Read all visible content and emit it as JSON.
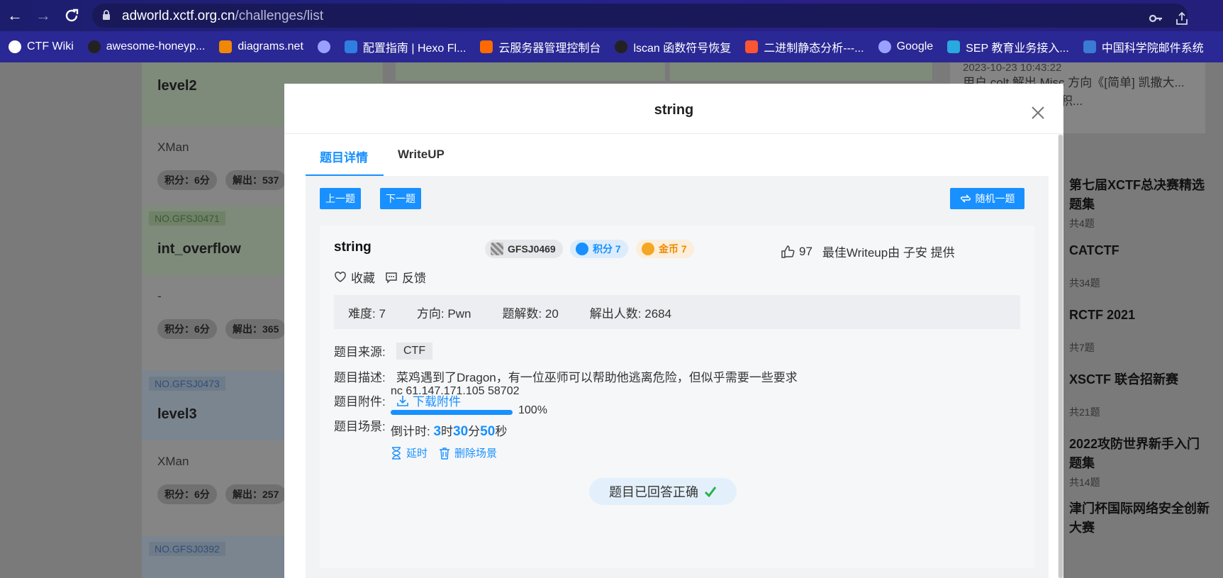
{
  "browser": {
    "url_domain": "adworld.xctf.org.cn",
    "url_path": "/challenges/list",
    "bookmarks": [
      {
        "label": "CTF Wiki",
        "icon": "ctfwiki-icon",
        "color": "#ffffff"
      },
      {
        "label": "awesome-honeyp...",
        "icon": "github-icon",
        "color": "#222222"
      },
      {
        "label": "diagrams.net",
        "icon": "diagrams-icon",
        "color": "#f08705"
      },
      {
        "label": "",
        "icon": "globe-icon",
        "color": "#9aa0ff"
      },
      {
        "label": "配置指南 | Hexo Fl...",
        "icon": "fluid-icon",
        "color": "#2f7fe0"
      },
      {
        "label": "云服务器管理控制台",
        "icon": "aliyun-icon",
        "color": "#ff6a00"
      },
      {
        "label": "lscan 函数符号恢复",
        "icon": "github-icon",
        "color": "#222222"
      },
      {
        "label": "二进制静态分析---...",
        "icon": "csdn-icon",
        "color": "#fc5531"
      },
      {
        "label": "Google",
        "icon": "globe-icon",
        "color": "#9aa0ff"
      },
      {
        "label": "SEP 教育业务接入...",
        "icon": "sep-icon",
        "color": "#2aa8e0"
      },
      {
        "label": "中国科学院邮件系统",
        "icon": "mail-icon",
        "color": "#3a7bd5"
      }
    ]
  },
  "background": {
    "cards": [
      {
        "tag": "",
        "name": "level2",
        "author": "XMan",
        "score": "积分：6分",
        "solves": "解出：537"
      },
      {
        "tag": "NO.GFSJ0471",
        "name": "int_overflow",
        "author": "-",
        "score": "积分：6分",
        "solves": "解出：365"
      },
      {
        "tag": "NO.GFSJ0473",
        "name": "level3",
        "author": "XMan",
        "score": "积分：6分",
        "solves": "解出：257"
      },
      {
        "tag": "NO.GFSJ0392",
        "name": "",
        "author": "",
        "score": "",
        "solves": ""
      }
    ],
    "news_time": "2023-10-23 10:43:22",
    "news_text": "用户 colt 解出 Misc 方向《[简单] 凯撒大...么》题目，获得 1 积...",
    "right_items": [
      {
        "title": "第七届XCTF总决赛精选题集",
        "count": "共4题"
      },
      {
        "title": "CATCTF",
        "count": "共34题"
      },
      {
        "title": "RCTF 2021",
        "count": "共7题"
      },
      {
        "title": "XSCTF 联合招新赛",
        "count": "共21题"
      },
      {
        "title": "2022攻防世界新手入门题集",
        "count": "共14题"
      },
      {
        "title": "津门杯国际网络安全创新大赛",
        "count": ""
      }
    ]
  },
  "modal": {
    "title": "string",
    "tabs": [
      "题目详情",
      "WriteUP"
    ],
    "prev_label": "上一题",
    "next_label": "下一题",
    "random_label": "随机一题",
    "challenge": {
      "name": "string",
      "id": "GFSJ0469",
      "points": "积分 7",
      "coins": "金币 7",
      "likes": "97",
      "best_writeup": "最佳Writeup由 子安 提供",
      "favorite": "收藏",
      "feedback": "反馈",
      "difficulty": "难度:  7",
      "direction": "方向:  Pwn",
      "writeups": "题解数:  20",
      "solvers": "解出人数:  2684",
      "source_label": "题目来源:",
      "source": "CTF",
      "desc_label": "题目描述:",
      "desc": "菜鸡遇到了Dragon，有一位巫师可以帮助他逃离危险，但似乎需要一些要求",
      "attach_label": "题目附件:",
      "attach_link": "下载附件",
      "scene_label": "题目场景:",
      "scene_addr": "nc 61.147.171.105 58702",
      "progress": 100,
      "progress_text": "100%",
      "countdown_label": "倒计时: ",
      "cd_h": "3",
      "cd_h_unit": "时",
      "cd_m": "30",
      "cd_m_unit": "分",
      "cd_s": "50",
      "cd_s_unit": "秒",
      "delay_label": "延时",
      "delete_label": "删除场景",
      "solved_text": "题目已回答正确"
    },
    "accent": "#1890ff"
  }
}
